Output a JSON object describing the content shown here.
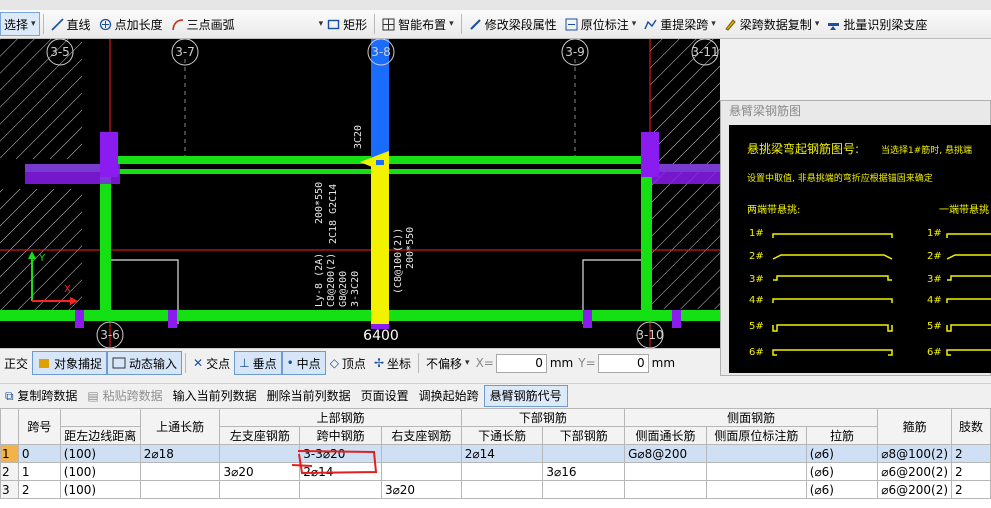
{
  "toolbar": {
    "select": "选择",
    "line": "直线",
    "point_length": "点加长度",
    "arc": "三点画弧",
    "rect": "矩形",
    "smart_layout": "智能布置",
    "modify_beam": "修改梁段属性",
    "in_situ": "原位标注",
    "re_span": "重提梁跨",
    "copy_span": "梁跨数据复制",
    "batch_support": "批量识别梁支座"
  },
  "canvas": {
    "axis_labels": [
      "3-5",
      "3-7",
      "3-8",
      "3-9",
      "3-11",
      "3-6",
      "3-10"
    ],
    "dimension": "6400",
    "beam_notes": [
      "3C20",
      "200*550",
      "2C18 G2C14",
      "Ly-8 (2A)",
      "C8@200(2)",
      "G8@200",
      "3-3C20",
      "(C8@100(2))",
      "200*550"
    ],
    "coord_y": "Y",
    "coord_x": "X"
  },
  "snapbar": {
    "ortho": "正交",
    "object_snap": "对象捕捉",
    "dynamic_input": "动态输入",
    "intersection": "交点",
    "perpendicular": "垂点",
    "midpoint": "中点",
    "vertex": "顶点",
    "coordinate": "坐标",
    "offset": "不偏移",
    "x_label": "X=",
    "x_value": "0",
    "x_unit": "mm",
    "y_label": "Y=",
    "y_value": "0",
    "y_unit": "mm"
  },
  "popup": {
    "title": "悬臂梁钢筋图",
    "heading": "悬挑梁弯起钢筋图号:",
    "note": "当选择1#筋时, 悬挑端",
    "note2": "设置中取值, 非悬挑端的弯折应根据锚固来确定",
    "both_ends": "两端带悬挑:",
    "one_end": "一端带悬挑",
    "left_labels": [
      "1#",
      "2#",
      "3#",
      "4#",
      "5#",
      "6#"
    ],
    "right_labels": [
      "1#",
      "2#",
      "3#",
      "4#",
      "5#",
      "6#"
    ]
  },
  "tabletools": {
    "copy_span": "复制跨数据",
    "paste_span": "粘贴跨数据",
    "input_col": "输入当前列数据",
    "delete_col": "删除当前列数据",
    "page_setup": "页面设置",
    "swap_start": "调换起始跨",
    "cantilever_code": "悬臂钢筋代号"
  },
  "table": {
    "header_top": {
      "span": "跨号",
      "top_through": "上通长筋",
      "upper": "上部钢筋",
      "lower": "下部钢筋",
      "side": "侧面钢筋",
      "stirrup": "箍筋",
      "legs": "肢数"
    },
    "header_sub": {
      "left_edge": "距左边线距离",
      "left_support": "左支座钢筋",
      "mid_span": "跨中钢筋",
      "right_support": "右支座钢筋",
      "bottom_through": "下通长筋",
      "bottom": "下部钢筋",
      "side_through": "侧面通长筋",
      "side_in_situ": "侧面原位标注筋",
      "tie": "拉筋"
    },
    "rows": [
      {
        "rn": "1",
        "span": "0",
        "dist": "(100)",
        "top": "2⌀18",
        "left": "",
        "mid": "3-3⌀20",
        "right": "",
        "bthru": "2⌀14",
        "bottom": "",
        "sthru": "G⌀8@200",
        "sinsitu": "",
        "tie": "(⌀6)",
        "stirrup": "⌀8@100(2)",
        "legs": "2"
      },
      {
        "rn": "2",
        "span": "1",
        "dist": "(100)",
        "top": "",
        "left": "3⌀20",
        "mid": "2⌀14",
        "right": "",
        "bthru": "",
        "bottom": "3⌀16",
        "sthru": "",
        "sinsitu": "",
        "tie": "(⌀6)",
        "stirrup": "⌀6@200(2)",
        "legs": "2"
      },
      {
        "rn": "3",
        "span": "2",
        "dist": "(100)",
        "top": "",
        "left": "",
        "mid": "",
        "right": "3⌀20",
        "bthru": "",
        "bottom": "",
        "sthru": "",
        "sinsitu": "",
        "tie": "(⌀6)",
        "stirrup": "⌀6@200(2)",
        "legs": "2"
      }
    ]
  },
  "colors": {
    "beam_green": "#14e014",
    "beam_yellow": "#f2f200",
    "beam_blue": "#1a6cff",
    "column_purple": "#8a1cf0",
    "axis_red": "#ff2020",
    "annotation_red": "#e02020"
  }
}
